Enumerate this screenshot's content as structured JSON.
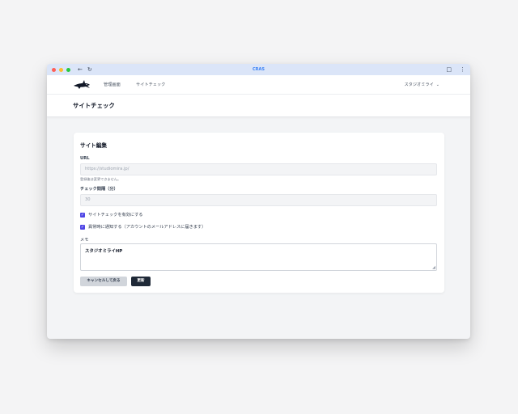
{
  "browser": {
    "title": "CRAS",
    "back_icon": "←",
    "reload_icon": "↻",
    "extensions_icon": "□",
    "menu_icon": "⋮"
  },
  "nav": {
    "links": [
      "管理画面",
      "サイトチェック"
    ],
    "user": "スタジオミライ",
    "user_chevron": "⌄"
  },
  "page": {
    "title": "サイトチェック"
  },
  "form": {
    "title": "サイト編集",
    "url": {
      "label": "URL",
      "value": "https://studiomira.jp/",
      "hint": "登録後は変更できません。"
    },
    "interval": {
      "label": "チェック間隔（分）",
      "value": "30"
    },
    "checkboxes": [
      {
        "label": "サイトチェックを有効にする",
        "checked": true
      },
      {
        "label": "異常時に通知する（アカウントのメールアドレスに届きます）",
        "checked": true
      }
    ],
    "memo": {
      "label": "メモ",
      "value": "スタジオミライHP"
    },
    "cancel_label": "キャンセルして戻る",
    "update_label": "更新"
  },
  "colors": {
    "accent": "#4f46e5",
    "primary_button": "#1f2937",
    "titlebar": "#dbe5f8"
  }
}
